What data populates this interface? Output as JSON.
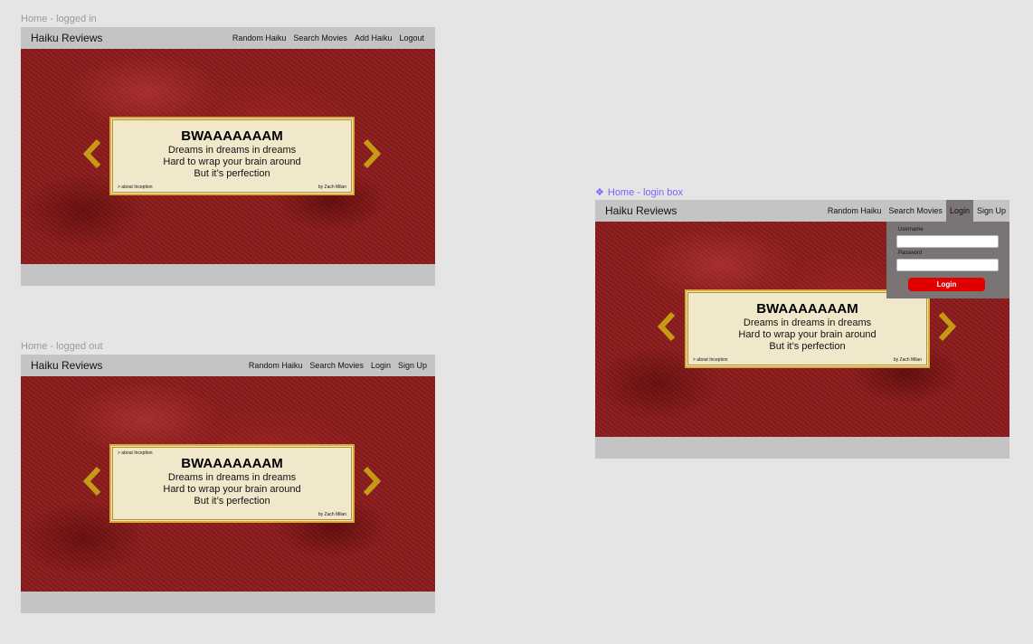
{
  "frames": {
    "logged_in": {
      "label": "Home - logged in",
      "brand": "Haiku Reviews",
      "nav": [
        "Random Haiku",
        "Search Movies",
        "Add Haiku",
        "Logout"
      ]
    },
    "logged_out": {
      "label": "Home - logged out",
      "brand": "Haiku Reviews",
      "nav": [
        "Random Haiku",
        "Search Movies",
        "Login",
        "Sign Up"
      ]
    },
    "login_box": {
      "label": "Home - login box",
      "brand": "Haiku Reviews",
      "nav": [
        "Random Haiku",
        "Search Movies",
        "Login",
        "Sign Up"
      ],
      "active_nav": "Login",
      "form": {
        "username_label": "Username",
        "username_value": "",
        "password_label": "Password",
        "password_value": "",
        "submit_label": "Login"
      }
    }
  },
  "haiku": {
    "title": "BWAAAAAAAM",
    "lines": [
      "Dreams in dreams in dreams",
      "Hard to wrap your brain around",
      "But it’s perfection"
    ],
    "about": "> about Inception",
    "author": "by Zach Milan"
  },
  "colors": {
    "canvas": "#e5e5e5",
    "navbar": "#c4c4c4",
    "hero": "#8e1a1a",
    "card": "#f1e8cb",
    "card_border": "#d6ab3a",
    "arrow": "#c79a14",
    "login_box": "#7a7474",
    "login_button": "#e00000",
    "component_label": "#7b61ff"
  },
  "icons": {
    "prev": "chevron-left-icon",
    "next": "chevron-right-icon",
    "component": "component-icon"
  }
}
